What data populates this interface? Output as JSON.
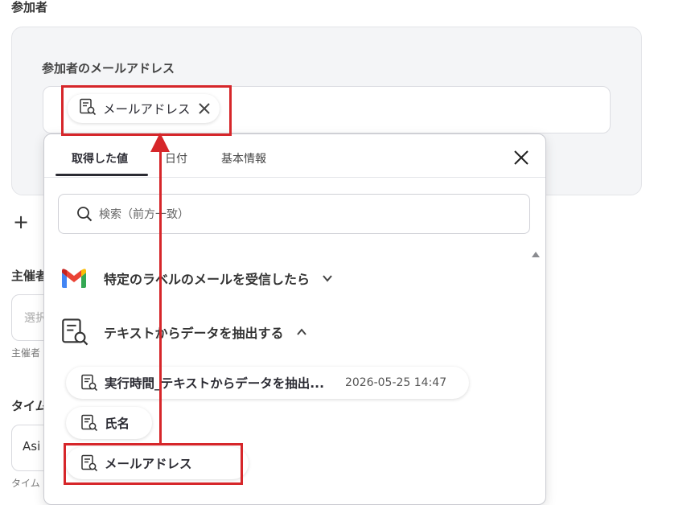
{
  "section_title": "参加者",
  "attendees": {
    "label": "参加者のメールアドレス",
    "chip_label": "メールアドレス"
  },
  "left_column": {
    "organizer_label": "主催者",
    "organizer_placeholder": "選択",
    "organizer_hint": "主催者",
    "timezone_label": "タイム",
    "timezone_value": "Asi",
    "timezone_hint": "タイム"
  },
  "dropdown": {
    "tabs": [
      {
        "label": "取得した値",
        "active": true
      },
      {
        "label": "日付",
        "active": false
      },
      {
        "label": "基本情報",
        "active": false
      }
    ],
    "search_placeholder": "検索（前方一致）",
    "groups": [
      {
        "label": "特定のラベルのメールを受信したら",
        "icon": "gmail-icon",
        "expanded": false
      },
      {
        "label": "テキストからデータを抽出する",
        "icon": "document-search-icon",
        "expanded": true
      }
    ],
    "items": [
      {
        "label": "実行時間_テキストからデータを抽出...",
        "timestamp": "2026-05-25 14:47"
      },
      {
        "label": "氏名"
      },
      {
        "label": "メールアドレス"
      }
    ]
  },
  "colors": {
    "highlight": "#d6262a",
    "panel_bg": "#f4f5f7",
    "gmail_red": "#ea4335",
    "gmail_blue": "#4285f4",
    "gmail_green": "#34a853",
    "gmail_yellow": "#fbbc04"
  }
}
